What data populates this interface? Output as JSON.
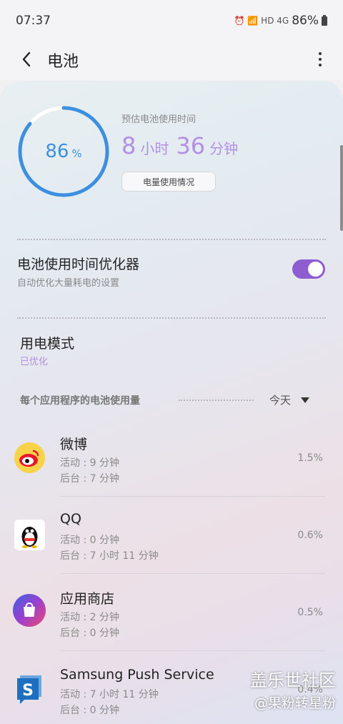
{
  "status": {
    "time": "07:37",
    "icons": "⏰ 📶 HD 4G",
    "battery": "86%"
  },
  "header": {
    "title": "电池"
  },
  "summary": {
    "percent": "86",
    "percent_unit": "%",
    "level": 0.86,
    "est_label": "预估电池使用时间",
    "est_hours": "8",
    "est_hours_unit": "小时",
    "est_minutes": "36",
    "est_minutes_unit": "分钟",
    "usage_button": "电量使用情况"
  },
  "optimizer": {
    "title": "电池使用时间优化器",
    "subtitle": "自动优化大量耗电的设置",
    "enabled": true
  },
  "power_mode": {
    "title": "用电模式",
    "value": "已优化"
  },
  "usage_section": {
    "label": "每个应用程序的电池使用量",
    "period": "今天"
  },
  "apps": [
    {
      "name": "微博",
      "active": "活动 : 9 分钟",
      "background": "后台 : 7 分钟",
      "percent": "1.5%",
      "icon": "weibo-icon"
    },
    {
      "name": "QQ",
      "active": "活动 : 0 分钟",
      "background": "后台 : 7 小时 11 分钟",
      "percent": "0.6%",
      "icon": "qq-icon"
    },
    {
      "name": "应用商店",
      "active": "活动 : 2 分钟",
      "background": "后台 : 0 分钟",
      "percent": "0.5%",
      "icon": "store-icon"
    },
    {
      "name": "Samsung Push Service",
      "active": "活动 : 7 小时 11 分钟",
      "background": "后台 : 0 分钟",
      "percent": "0.4%",
      "icon": "samsung-push-icon"
    }
  ],
  "watermark": {
    "line1": "盖乐世社区",
    "line2": "@果粉转星粉"
  },
  "colors": {
    "accent": "#8e5dd1",
    "ring": "#3d8fe0",
    "estimate": "#b38fe6"
  }
}
